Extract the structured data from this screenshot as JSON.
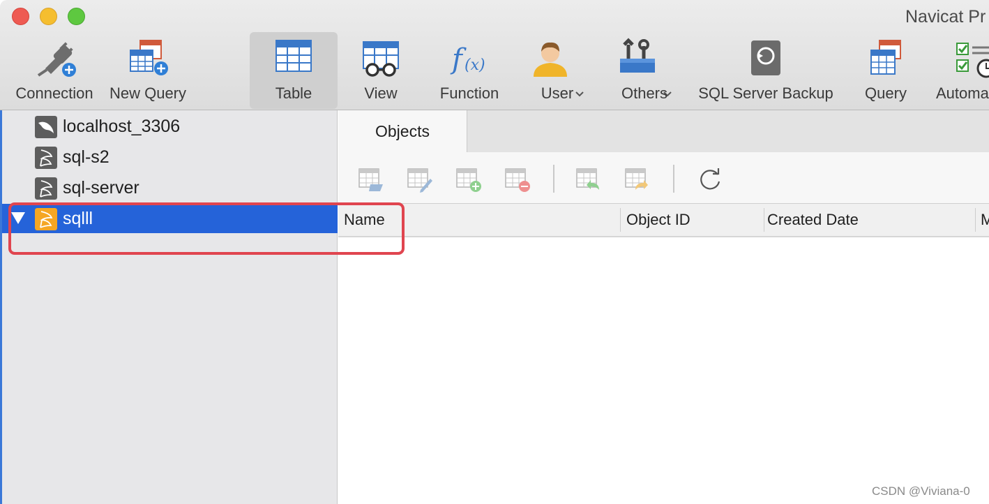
{
  "window": {
    "title": "Navicat Pr"
  },
  "toolbar": {
    "connection": "Connection",
    "new_query": "New Query",
    "table": "Table",
    "view": "View",
    "function": "Function",
    "user": "User",
    "others": "Others",
    "backup": "SQL Server Backup",
    "query": "Query",
    "automation": "Automa"
  },
  "sidebar": {
    "connections": [
      {
        "label": "localhost_3306",
        "type": "mysql"
      },
      {
        "label": "sql-s2",
        "type": "sqlserver"
      },
      {
        "label": "sql-server",
        "type": "sqlserver"
      },
      {
        "label": "sqlll",
        "type": "sqlserver",
        "selected": true,
        "expanded": true
      }
    ]
  },
  "tabs": {
    "objects": "Objects"
  },
  "columns": {
    "name": "Name",
    "object_id": "Object ID",
    "created_date": "Created Date",
    "next": "M"
  },
  "watermark": "CSDN @Viviana-0",
  "colors": {
    "selection": "#2563d9",
    "highlight_box": "#e0454f",
    "sqlserver_icon": "#f5a623"
  }
}
